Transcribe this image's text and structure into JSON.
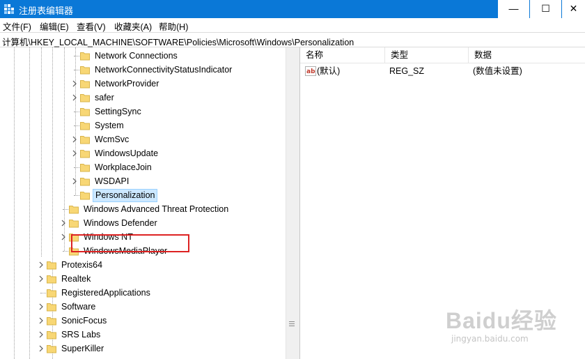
{
  "window": {
    "title": "注册表编辑器",
    "minimize_glyph": "—",
    "maximize_glyph": "☐",
    "close_glyph": "✕"
  },
  "menu": [
    "文件(F)",
    "编辑(E)",
    "查看(V)",
    "收藏夹(A)",
    "帮助(H)"
  ],
  "address": "计算机\\HKEY_LOCAL_MACHINE\\SOFTWARE\\Policies\\Microsoft\\Windows\\Personalization",
  "tree": {
    "deep_items": [
      {
        "label": "Network Connections",
        "expandable": false
      },
      {
        "label": "NetworkConnectivityStatusIndicator",
        "expandable": false
      },
      {
        "label": "NetworkProvider",
        "expandable": true
      },
      {
        "label": "safer",
        "expandable": true
      },
      {
        "label": "SettingSync",
        "expandable": false
      },
      {
        "label": "System",
        "expandable": false
      },
      {
        "label": "WcmSvc",
        "expandable": true
      },
      {
        "label": "WindowsUpdate",
        "expandable": true
      },
      {
        "label": "WorkplaceJoin",
        "expandable": false
      },
      {
        "label": "WSDAPI",
        "expandable": true
      },
      {
        "label": "Personalization",
        "expandable": false,
        "selected": true
      }
    ],
    "mid_items": [
      {
        "label": "Windows Advanced Threat Protection",
        "expandable": false
      },
      {
        "label": "Windows Defender",
        "expandable": true
      },
      {
        "label": "Windows NT",
        "expandable": true
      },
      {
        "label": "WindowsMediaPlayer",
        "expandable": false
      }
    ],
    "top_items": [
      {
        "label": "Protexis64",
        "expandable": true
      },
      {
        "label": "Realtek",
        "expandable": true
      },
      {
        "label": "RegisteredApplications",
        "expandable": false
      },
      {
        "label": "Software",
        "expandable": true
      },
      {
        "label": "SonicFocus",
        "expandable": true
      },
      {
        "label": "SRS Labs",
        "expandable": true
      },
      {
        "label": "SuperKiller",
        "expandable": true
      }
    ]
  },
  "list": {
    "headers": {
      "name": "名称",
      "type": "类型",
      "data": "数据"
    },
    "rows": [
      {
        "name": "(默认)",
        "type": "REG_SZ",
        "data": "(数值未设置)"
      }
    ]
  },
  "watermark": {
    "brand": "Baidu经验",
    "url": "jingyan.baidu.com"
  },
  "colors": {
    "titlebar": "#0a78d7",
    "selection": "#cce8ff",
    "highlight_box": "#dd2222",
    "folder": "#f8d775"
  }
}
